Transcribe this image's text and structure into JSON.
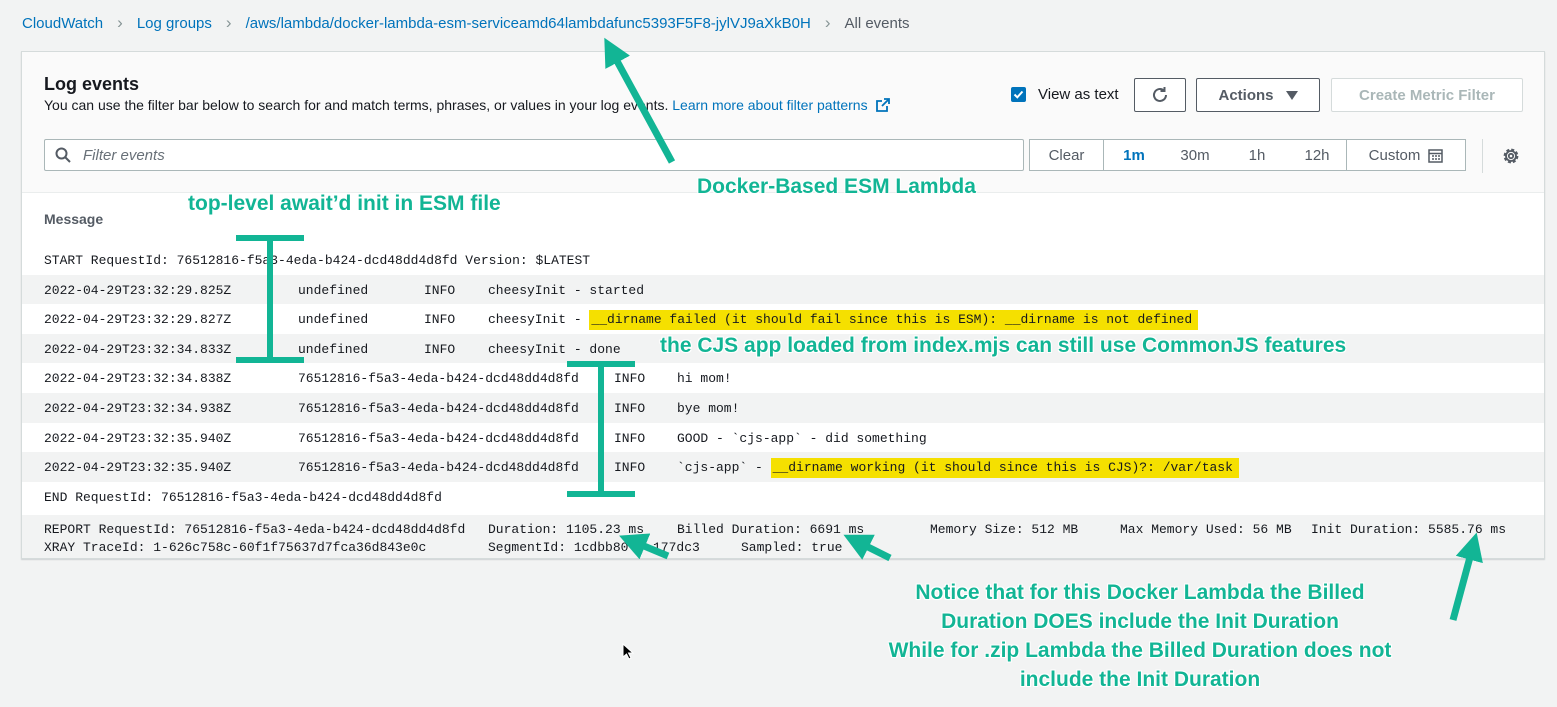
{
  "breadcrumb": {
    "items": [
      "CloudWatch",
      "Log groups",
      "/aws/lambda/docker-lambda-esm-serviceamd64lambdafunc5393F5F8-jylVJ9aXkB0H"
    ],
    "current": "All events"
  },
  "panel": {
    "title": "Log events",
    "description": "You can use the filter bar below to search for and match terms, phrases, or values in your log events.",
    "learn_more": "Learn more about filter patterns",
    "view_as_text_label": "View as text",
    "view_as_text_checked": true,
    "actions_label": "Actions",
    "create_metric_filter_label": "Create Metric Filter",
    "filter_placeholder": "Filter events",
    "time_range": {
      "clear": "Clear",
      "options": [
        "1m",
        "30m",
        "1h",
        "12h"
      ],
      "selected": "1m",
      "custom": "Custom"
    },
    "column_header": "Message"
  },
  "log_rows": [
    {
      "text": "START RequestId: 76512816-f5a3-4eda-b424-dcd48dd4d8fd Version: $LATEST"
    },
    {
      "ts": "2022-04-29T23:32:29.825Z",
      "req": "undefined",
      "level": "INFO",
      "msg": "cheesyInit - started"
    },
    {
      "ts": "2022-04-29T23:32:29.827Z",
      "req": "undefined",
      "level": "INFO",
      "msg_prefix": "cheesyInit - ",
      "msg_hl": "__dirname failed (it should fail since this is ESM): __dirname is not defined"
    },
    {
      "ts": "2022-04-29T23:32:34.833Z",
      "req": "undefined",
      "level": "INFO",
      "msg": "cheesyInit - done"
    },
    {
      "ts": "2022-04-29T23:32:34.838Z",
      "req": "76512816-f5a3-4eda-b424-dcd48dd4d8fd",
      "level": "INFO",
      "msg": "hi mom!"
    },
    {
      "ts": "2022-04-29T23:32:34.938Z",
      "req": "76512816-f5a3-4eda-b424-dcd48dd4d8fd",
      "level": "INFO",
      "msg": "bye mom!"
    },
    {
      "ts": "2022-04-29T23:32:35.940Z",
      "req": "76512816-f5a3-4eda-b424-dcd48dd4d8fd",
      "level": "INFO",
      "msg": "GOOD - `cjs-app` - did something"
    },
    {
      "ts": "2022-04-29T23:32:35.940Z",
      "req": "76512816-f5a3-4eda-b424-dcd48dd4d8fd",
      "level": "INFO",
      "msg_prefix": "`cjs-app` - ",
      "msg_hl": "__dirname working (it should since this is CJS)?: /var/task"
    },
    {
      "text": "END RequestId: 76512816-f5a3-4eda-b424-dcd48dd4d8fd"
    }
  ],
  "report": {
    "request": "REPORT RequestId: 76512816-f5a3-4eda-b424-dcd48dd4d8fd",
    "duration": "Duration: 1105.23 ms",
    "billed": "Billed Duration: 6691 ms",
    "memory": "Memory Size: 512 MB",
    "max_memory": "Max Memory Used: 56 MB",
    "init": "Init Duration: 5585.76 ms",
    "trace": "XRAY TraceId: 1-626c758c-60f1f75637d7fca36d843e0c",
    "segment": "SegmentId: 1cdbb80",
    "segment_tail": "177dc3",
    "sampled": "Sampled: true"
  },
  "annotations": {
    "docker": "Docker-Based ESM Lambda",
    "top_level": "top-level await’d init in ESM file",
    "cjs": "the CJS app loaded from index.mjs can still use CommonJS features",
    "notice": [
      "Notice that for this Docker Lambda the Billed",
      "Duration DOES include the Init Duration",
      "While for .zip Lambda the Billed Duration does not",
      "include the Init Duration"
    ]
  },
  "colors": {
    "link": "#0073bb",
    "annotation": "#12b595",
    "highlight": "#f5e000"
  },
  "icons": [
    "chevron-right-icon",
    "external-link-icon",
    "checkbox-checked-icon",
    "refresh-icon",
    "caret-down-icon",
    "search-icon",
    "calendar-icon",
    "gear-icon"
  ]
}
